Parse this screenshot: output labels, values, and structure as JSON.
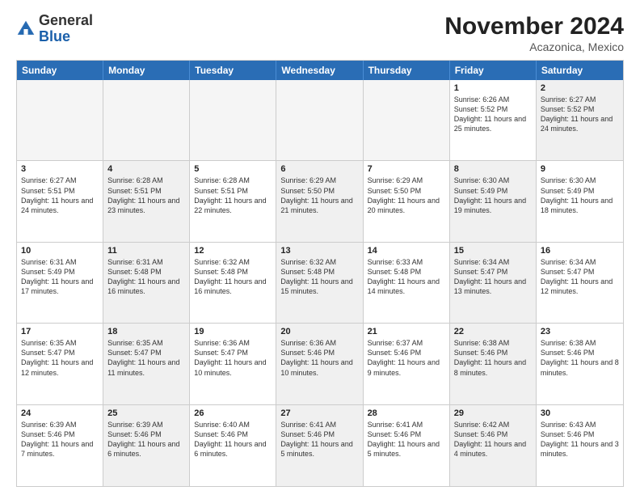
{
  "logo": {
    "general": "General",
    "blue": "Blue"
  },
  "header": {
    "month_title": "November 2024",
    "location": "Acazonica, Mexico"
  },
  "weekdays": [
    "Sunday",
    "Monday",
    "Tuesday",
    "Wednesday",
    "Thursday",
    "Friday",
    "Saturday"
  ],
  "rows": [
    [
      {
        "day": "",
        "empty": true,
        "text": ""
      },
      {
        "day": "",
        "empty": true,
        "text": ""
      },
      {
        "day": "",
        "empty": true,
        "text": ""
      },
      {
        "day": "",
        "empty": true,
        "text": ""
      },
      {
        "day": "",
        "empty": true,
        "text": ""
      },
      {
        "day": "1",
        "empty": false,
        "shaded": false,
        "text": "Sunrise: 6:26 AM\nSunset: 5:52 PM\nDaylight: 11 hours and 25 minutes."
      },
      {
        "day": "2",
        "empty": false,
        "shaded": true,
        "text": "Sunrise: 6:27 AM\nSunset: 5:52 PM\nDaylight: 11 hours and 24 minutes."
      }
    ],
    [
      {
        "day": "3",
        "empty": false,
        "shaded": false,
        "text": "Sunrise: 6:27 AM\nSunset: 5:51 PM\nDaylight: 11 hours and 24 minutes."
      },
      {
        "day": "4",
        "empty": false,
        "shaded": true,
        "text": "Sunrise: 6:28 AM\nSunset: 5:51 PM\nDaylight: 11 hours and 23 minutes."
      },
      {
        "day": "5",
        "empty": false,
        "shaded": false,
        "text": "Sunrise: 6:28 AM\nSunset: 5:51 PM\nDaylight: 11 hours and 22 minutes."
      },
      {
        "day": "6",
        "empty": false,
        "shaded": true,
        "text": "Sunrise: 6:29 AM\nSunset: 5:50 PM\nDaylight: 11 hours and 21 minutes."
      },
      {
        "day": "7",
        "empty": false,
        "shaded": false,
        "text": "Sunrise: 6:29 AM\nSunset: 5:50 PM\nDaylight: 11 hours and 20 minutes."
      },
      {
        "day": "8",
        "empty": false,
        "shaded": true,
        "text": "Sunrise: 6:30 AM\nSunset: 5:49 PM\nDaylight: 11 hours and 19 minutes."
      },
      {
        "day": "9",
        "empty": false,
        "shaded": false,
        "text": "Sunrise: 6:30 AM\nSunset: 5:49 PM\nDaylight: 11 hours and 18 minutes."
      }
    ],
    [
      {
        "day": "10",
        "empty": false,
        "shaded": false,
        "text": "Sunrise: 6:31 AM\nSunset: 5:49 PM\nDaylight: 11 hours and 17 minutes."
      },
      {
        "day": "11",
        "empty": false,
        "shaded": true,
        "text": "Sunrise: 6:31 AM\nSunset: 5:48 PM\nDaylight: 11 hours and 16 minutes."
      },
      {
        "day": "12",
        "empty": false,
        "shaded": false,
        "text": "Sunrise: 6:32 AM\nSunset: 5:48 PM\nDaylight: 11 hours and 16 minutes."
      },
      {
        "day": "13",
        "empty": false,
        "shaded": true,
        "text": "Sunrise: 6:32 AM\nSunset: 5:48 PM\nDaylight: 11 hours and 15 minutes."
      },
      {
        "day": "14",
        "empty": false,
        "shaded": false,
        "text": "Sunrise: 6:33 AM\nSunset: 5:48 PM\nDaylight: 11 hours and 14 minutes."
      },
      {
        "day": "15",
        "empty": false,
        "shaded": true,
        "text": "Sunrise: 6:34 AM\nSunset: 5:47 PM\nDaylight: 11 hours and 13 minutes."
      },
      {
        "day": "16",
        "empty": false,
        "shaded": false,
        "text": "Sunrise: 6:34 AM\nSunset: 5:47 PM\nDaylight: 11 hours and 12 minutes."
      }
    ],
    [
      {
        "day": "17",
        "empty": false,
        "shaded": false,
        "text": "Sunrise: 6:35 AM\nSunset: 5:47 PM\nDaylight: 11 hours and 12 minutes."
      },
      {
        "day": "18",
        "empty": false,
        "shaded": true,
        "text": "Sunrise: 6:35 AM\nSunset: 5:47 PM\nDaylight: 11 hours and 11 minutes."
      },
      {
        "day": "19",
        "empty": false,
        "shaded": false,
        "text": "Sunrise: 6:36 AM\nSunset: 5:47 PM\nDaylight: 11 hours and 10 minutes."
      },
      {
        "day": "20",
        "empty": false,
        "shaded": true,
        "text": "Sunrise: 6:36 AM\nSunset: 5:46 PM\nDaylight: 11 hours and 10 minutes."
      },
      {
        "day": "21",
        "empty": false,
        "shaded": false,
        "text": "Sunrise: 6:37 AM\nSunset: 5:46 PM\nDaylight: 11 hours and 9 minutes."
      },
      {
        "day": "22",
        "empty": false,
        "shaded": true,
        "text": "Sunrise: 6:38 AM\nSunset: 5:46 PM\nDaylight: 11 hours and 8 minutes."
      },
      {
        "day": "23",
        "empty": false,
        "shaded": false,
        "text": "Sunrise: 6:38 AM\nSunset: 5:46 PM\nDaylight: 11 hours and 8 minutes."
      }
    ],
    [
      {
        "day": "24",
        "empty": false,
        "shaded": false,
        "text": "Sunrise: 6:39 AM\nSunset: 5:46 PM\nDaylight: 11 hours and 7 minutes."
      },
      {
        "day": "25",
        "empty": false,
        "shaded": true,
        "text": "Sunrise: 6:39 AM\nSunset: 5:46 PM\nDaylight: 11 hours and 6 minutes."
      },
      {
        "day": "26",
        "empty": false,
        "shaded": false,
        "text": "Sunrise: 6:40 AM\nSunset: 5:46 PM\nDaylight: 11 hours and 6 minutes."
      },
      {
        "day": "27",
        "empty": false,
        "shaded": true,
        "text": "Sunrise: 6:41 AM\nSunset: 5:46 PM\nDaylight: 11 hours and 5 minutes."
      },
      {
        "day": "28",
        "empty": false,
        "shaded": false,
        "text": "Sunrise: 6:41 AM\nSunset: 5:46 PM\nDaylight: 11 hours and 5 minutes."
      },
      {
        "day": "29",
        "empty": false,
        "shaded": true,
        "text": "Sunrise: 6:42 AM\nSunset: 5:46 PM\nDaylight: 11 hours and 4 minutes."
      },
      {
        "day": "30",
        "empty": false,
        "shaded": false,
        "text": "Sunrise: 6:43 AM\nSunset: 5:46 PM\nDaylight: 11 hours and 3 minutes."
      }
    ]
  ]
}
